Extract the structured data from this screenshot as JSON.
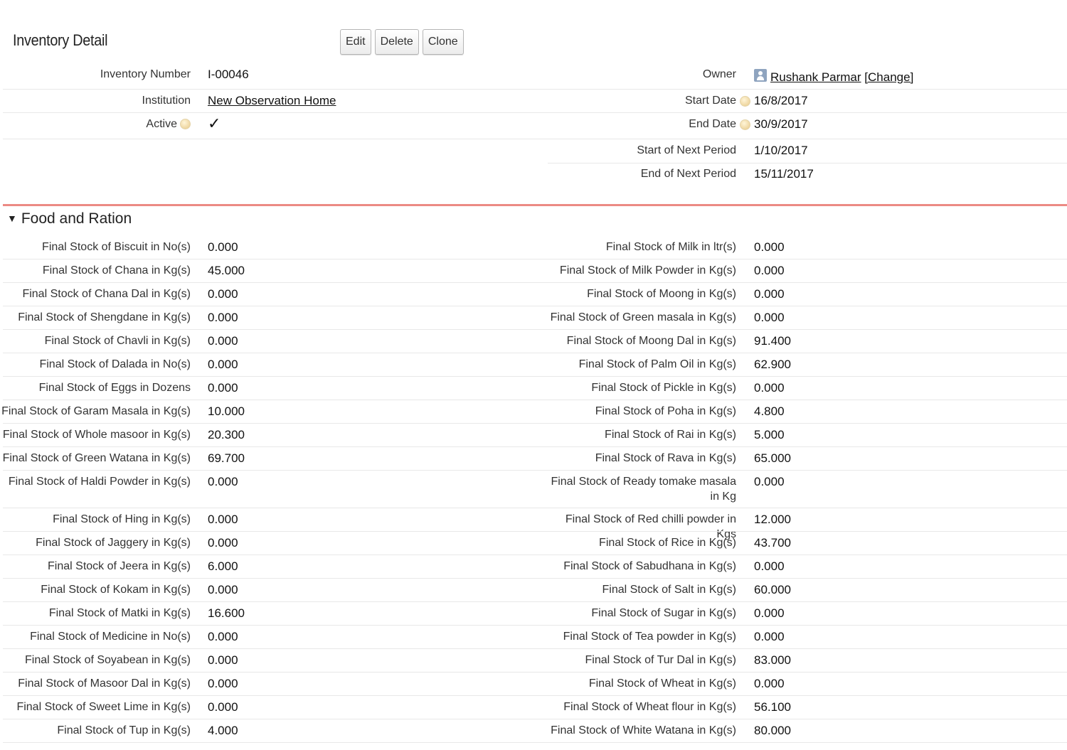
{
  "header": {
    "title": "Inventory Detail",
    "buttons": [
      "Edit",
      "Delete",
      "Clone"
    ]
  },
  "details": {
    "inventory_number_label": "Inventory Number",
    "inventory_number": "I-00046",
    "institution_label": "Institution",
    "institution": "New Observation Home",
    "active_label": "Active",
    "active_check": "✓",
    "owner_label": "Owner",
    "owner": "Rushank Parmar",
    "change_link": "[Change]",
    "start_date_label": "Start Date",
    "start_date": "16/8/2017",
    "end_date_label": "End Date",
    "end_date": "30/9/2017",
    "start_next_label": "Start of Next Period",
    "start_next": "1/10/2017",
    "end_next_label": "End of Next Period",
    "end_next": "15/11/2017"
  },
  "section": {
    "title": "Food and Ration",
    "toggle_icon": "triangle-down-icon"
  },
  "rows": [
    {
      "l": "Final Stock of Biscuit in No(s)",
      "lv": "0.000",
      "r": "Final Stock of Milk in ltr(s)",
      "rv": "0.000"
    },
    {
      "l": "Final Stock of Chana in Kg(s)",
      "lv": "45.000",
      "r": "Final Stock of Milk Powder in Kg(s)",
      "rv": "0.000"
    },
    {
      "l": "Final Stock of Chana Dal in Kg(s)",
      "lv": "0.000",
      "r": "Final Stock of Moong in Kg(s)",
      "rv": "0.000"
    },
    {
      "l": "Final Stock of Shengdane in Kg(s)",
      "lv": "0.000",
      "r": "Final Stock of Green masala in Kg(s)",
      "rv": "0.000"
    },
    {
      "l": "Final Stock of Chavli in Kg(s)",
      "lv": "0.000",
      "r": "Final Stock of Moong Dal in Kg(s)",
      "rv": "91.400"
    },
    {
      "l": "Final Stock of Dalada in No(s)",
      "lv": "0.000",
      "r": "Final Stock of Palm Oil in Kg(s)",
      "rv": "62.900"
    },
    {
      "l": "Final Stock of Eggs in Dozens",
      "lv": "0.000",
      "r": "Final Stock of Pickle in Kg(s)",
      "rv": "0.000"
    },
    {
      "l": "Final Stock of Garam Masala in Kg(s)",
      "lv": "10.000",
      "r": "Final Stock of Poha in Kg(s)",
      "rv": "4.800"
    },
    {
      "l": "Final Stock of Whole masoor in Kg(s)",
      "lv": "20.300",
      "r": "Final Stock of Rai in Kg(s)",
      "rv": "5.000"
    },
    {
      "l": "Final Stock of Green Watana in Kg(s)",
      "lv": "69.700",
      "r": "Final Stock of Rava in Kg(s)",
      "rv": "65.000"
    },
    {
      "l": "Final Stock of Haldi Powder in Kg(s)",
      "lv": "0.000",
      "r": "Final Stock of Ready tomake masala in Kg",
      "rv": "0.000"
    },
    {
      "l": "Final Stock of Hing in Kg(s)",
      "lv": "0.000",
      "r": "Final Stock of Red chilli powder in Kgs",
      "rv": "12.000"
    },
    {
      "l": "Final Stock of Jaggery in Kg(s)",
      "lv": "0.000",
      "r": "Final Stock of Rice in Kg(s)",
      "rv": "43.700"
    },
    {
      "l": "Final Stock of Jeera in Kg(s)",
      "lv": "6.000",
      "r": "Final Stock of Sabudhana in Kg(s)",
      "rv": "0.000"
    },
    {
      "l": "Final Stock of Kokam in Kg(s)",
      "lv": "0.000",
      "r": "Final Stock of Salt in Kg(s)",
      "rv": "60.000"
    },
    {
      "l": "Final Stock of Matki in Kg(s)",
      "lv": "16.600",
      "r": "Final Stock of Sugar in Kg(s)",
      "rv": "0.000"
    },
    {
      "l": "Final Stock of Medicine in No(s)",
      "lv": "0.000",
      "r": "Final Stock of Tea powder in Kg(s)",
      "rv": "0.000"
    },
    {
      "l": "Final Stock of Soyabean in Kg(s)",
      "lv": "0.000",
      "r": "Final Stock of Tur Dal in Kg(s)",
      "rv": "83.000"
    },
    {
      "l": "Final Stock of Masoor Dal in Kg(s)",
      "lv": "0.000",
      "r": "Final Stock of Wheat in Kg(s)",
      "rv": "0.000"
    },
    {
      "l": "Final Stock of Sweet Lime in Kg(s)",
      "lv": "0.000",
      "r": "Final Stock of Wheat flour in Kg(s)",
      "rv": "56.100"
    },
    {
      "l": "Final Stock of Tup in Kg(s)",
      "lv": "4.000",
      "r": "Final Stock of White Watana in Kg(s)",
      "rv": "80.000"
    }
  ]
}
